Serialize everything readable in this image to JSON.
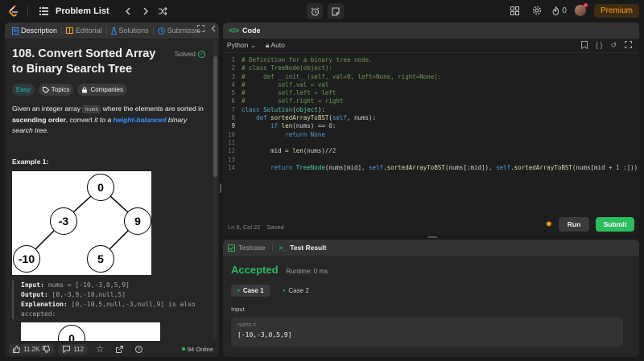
{
  "topbar": {
    "problem_list_label": "Problem List",
    "streak_count": "0",
    "premium_label": "Premium"
  },
  "left": {
    "tabs": [
      {
        "label": "Description"
      },
      {
        "label": "Editorial"
      },
      {
        "label": "Solutions"
      },
      {
        "label": "Submissio"
      }
    ],
    "title": "108. Convert Sorted Array to Binary Search Tree",
    "solved_label": "Solved",
    "tags": {
      "difficulty": "Easy",
      "topics": "Topics",
      "companies": "Companies"
    },
    "desc": {
      "p1": "Given an integer array ",
      "code": "nums",
      "p2": " where the elements are sorted in ",
      "bold": "ascending order",
      "p3": ", convert ",
      "it": "it to a ",
      "link": "height-balanced",
      "p4": " binary search tree."
    },
    "example_heading": "Example 1:",
    "tree": {
      "root": "0",
      "left": "-3",
      "right": "9",
      "left_left": "-10",
      "right_left": "5",
      "next_root": "0"
    },
    "example": {
      "input_label": "Input:",
      "input_val": "nums = [-10,-3,0,5,9]",
      "output_label": "Output:",
      "output_val": "[0,-3,9,-10,null,5]",
      "explanation_label": "Explanation:",
      "explanation_val": "[0,-10,5,null,-3,null,9] is also accepted:"
    },
    "bottom": {
      "likes": "11.2K",
      "comments": "112",
      "online": "94 Online"
    }
  },
  "code": {
    "tab_label": "Code",
    "language": "Python",
    "mode": "Auto",
    "status_pos": "Ln 9, Col 22",
    "status_saved": "Saved",
    "run_label": "Run",
    "submit_label": "Submit"
  },
  "result": {
    "tab_testcase": "Testcase",
    "tab_result": "Test Result",
    "status": "Accepted",
    "runtime": "Runtime: 0 ms",
    "cases": [
      "Case 1",
      "Case 2"
    ],
    "input_label": "Input",
    "input_name": "nums =",
    "input_value": "[-10,-3,0,5,9]"
  }
}
